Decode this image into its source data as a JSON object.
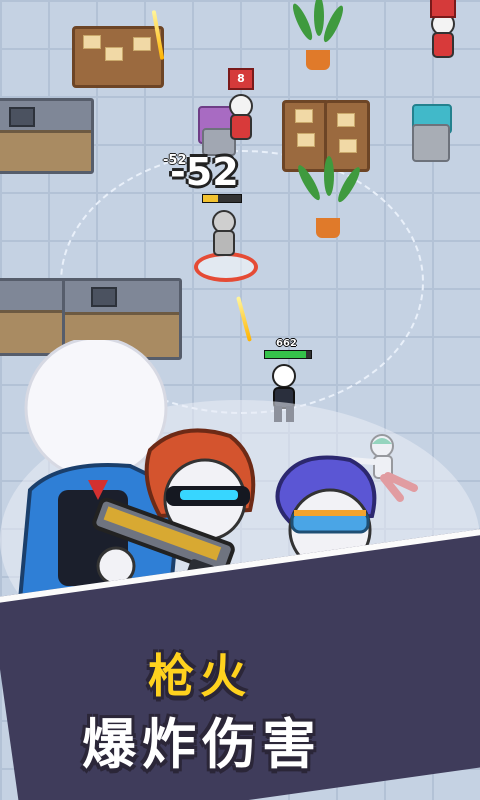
{
  "hud": {
    "damage_main": "-52",
    "damage_small": "-52",
    "player_hp": "662",
    "enemy_top_level": "8"
  },
  "promo": {
    "line1": "枪火",
    "line2": "爆炸伤害"
  },
  "colors": {
    "title_yellow": "#ffd21e",
    "banner_dark": "#3f3c5b",
    "enemy_red": "#d83a3a",
    "player_hp_green": "#35c24a"
  }
}
